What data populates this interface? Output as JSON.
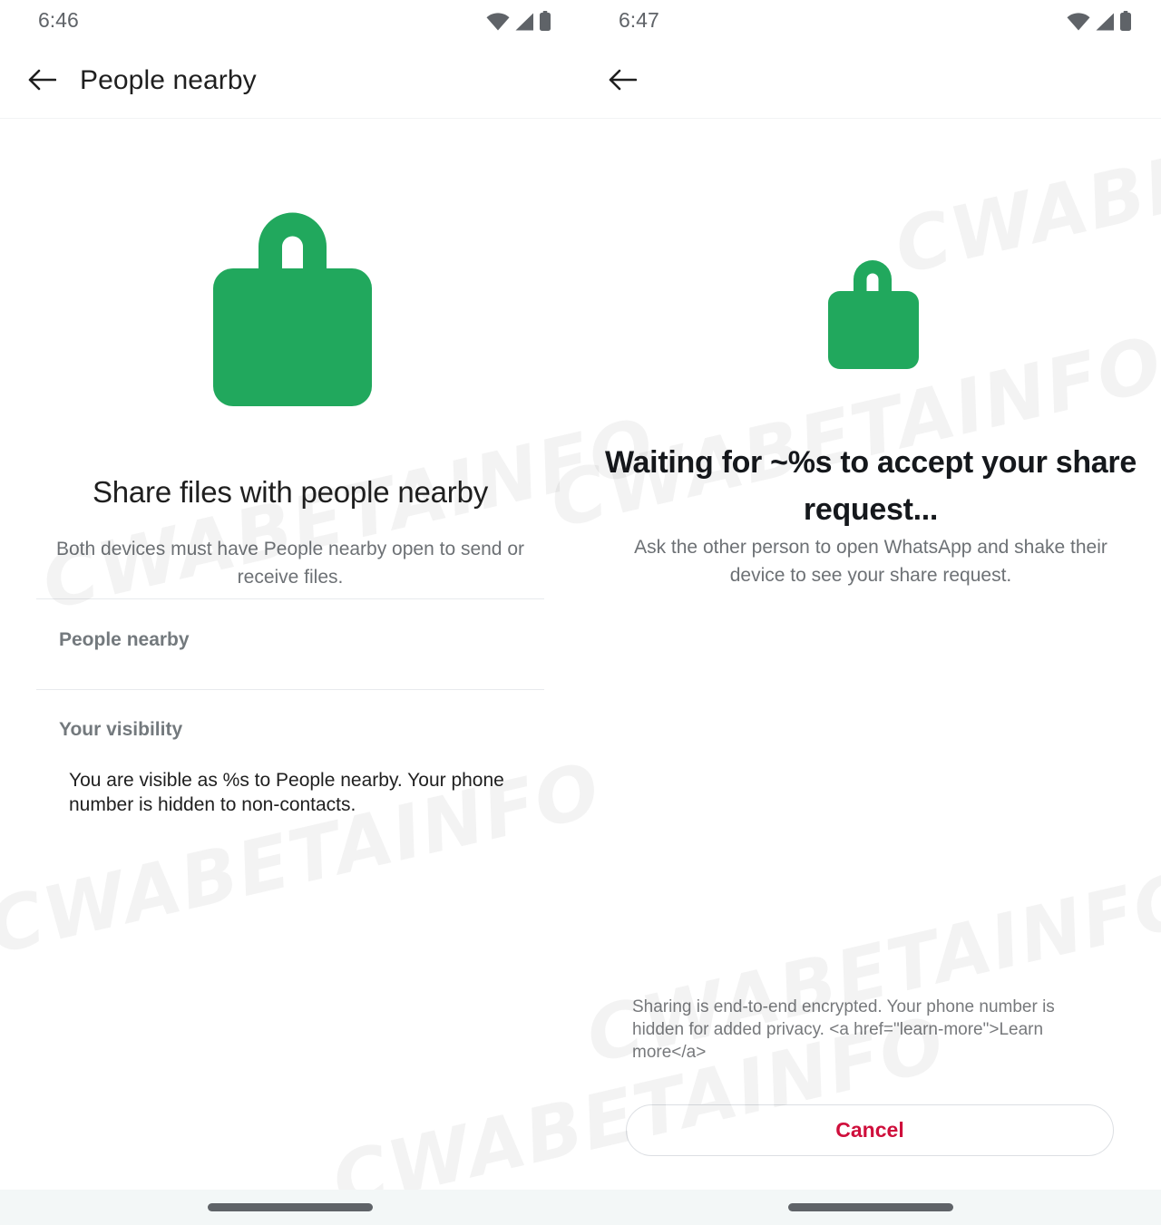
{
  "theme": {
    "brand_green": "#21a85d",
    "cancel_red": "#cf0f3c",
    "text_primary": "#1f1f1f",
    "text_secondary": "#6d7175",
    "section_header": "#73797d",
    "divider": "#e8eaed",
    "navbar_bg": "#f3f7f7"
  },
  "watermark": {
    "text": "CWABETAINFO"
  },
  "left_panel": {
    "status_bar": {
      "time": "6:46",
      "icons": [
        "wifi-icon",
        "cellular-signal-icon",
        "battery-icon"
      ]
    },
    "app_bar": {
      "back_icon": "back-arrow-icon",
      "title": "People nearby"
    },
    "hero": {
      "icon": "lock-icon",
      "title": "Share files with people nearby",
      "subtitle": "Both devices must have People nearby open to send or receive files."
    },
    "sections": [
      {
        "header": "People nearby"
      },
      {
        "header": "Your visibility",
        "body": "You are visible as %s to People nearby. Your phone number is hidden to non-contacts."
      }
    ],
    "nav_pill": "home-gesture-pill"
  },
  "right_panel": {
    "status_bar": {
      "time": "6:47",
      "icons": [
        "wifi-icon",
        "cellular-signal-icon",
        "battery-icon"
      ]
    },
    "app_bar": {
      "back_icon": "back-arrow-icon",
      "title": ""
    },
    "hero": {
      "icon": "lock-icon",
      "title": "Waiting for ~%s to accept your share request...",
      "subtitle": "Ask the other person to open WhatsApp and shake their device to see your share request."
    },
    "footnote": "Sharing is end-to-end encrypted. Your phone number is hidden for added privacy. <a href=\"learn-more\">Learn more</a>",
    "cancel_label": "Cancel",
    "nav_pill": "home-gesture-pill"
  }
}
